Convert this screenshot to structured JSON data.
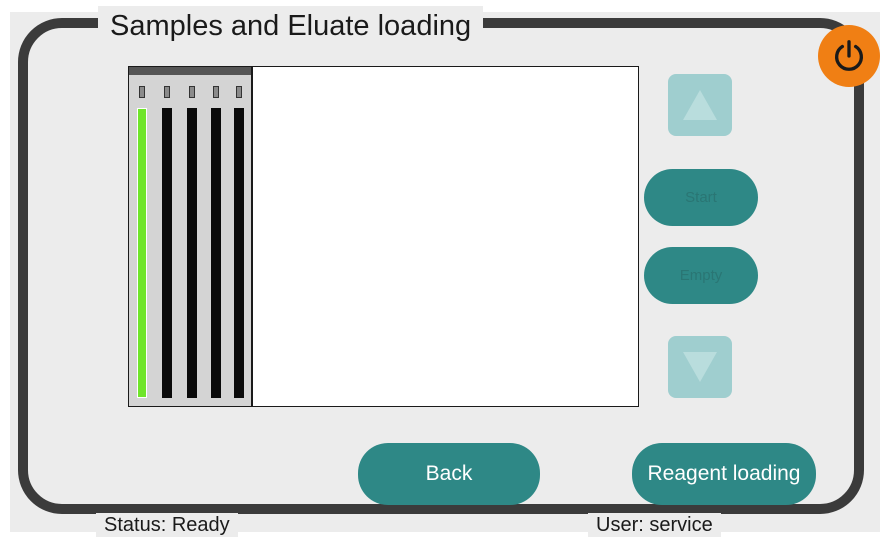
{
  "title": "Samples and Eluate loading",
  "status": "Status: Ready",
  "user": "User: service",
  "side_buttons": {
    "up_icon": "triangle-up",
    "button1_label": "Start",
    "button2_label": "Empty",
    "down_icon": "triangle-down"
  },
  "bottom_buttons": {
    "back_label": "Back",
    "reagent_label": "Reagent loading"
  },
  "tubes": [
    {
      "state": "filled",
      "color": "#6fe52a"
    },
    {
      "state": "empty",
      "color": "#0a0a0a"
    },
    {
      "state": "empty",
      "color": "#0a0a0a"
    },
    {
      "state": "empty",
      "color": "#0a0a0a"
    },
    {
      "state": "empty",
      "color": "#0a0a0a"
    }
  ],
  "colors": {
    "accent": "#2e8886",
    "disabled_accent": "#9fcecf",
    "power": "#f07f14",
    "frame": "#3b3b3b"
  }
}
